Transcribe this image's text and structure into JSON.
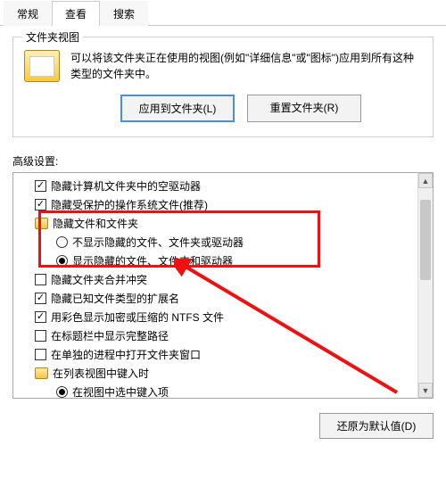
{
  "tabs": {
    "t0": "常规",
    "t1": "查看",
    "t2": "搜索"
  },
  "group": {
    "label": "文件夹视图",
    "desc": "可以将该文件夹正在使用的视图(例如\"详细信息\"或\"图标\")应用到所有这种类型的文件夹中。",
    "apply": "应用到文件夹(L)",
    "reset": "重置文件夹(R)"
  },
  "adv_label": "高级设置:",
  "items": [
    {
      "type": "check",
      "checked": true,
      "label": "隐藏计算机文件夹中的空驱动器"
    },
    {
      "type": "check",
      "checked": true,
      "label": "隐藏受保护的操作系统文件(推荐)"
    },
    {
      "type": "folder",
      "label": "隐藏文件和文件夹"
    },
    {
      "type": "radio",
      "selected": false,
      "sub": true,
      "label": "不显示隐藏的文件、文件夹或驱动器"
    },
    {
      "type": "radio",
      "selected": true,
      "sub": true,
      "label": "显示隐藏的文件、文件夹和驱动器"
    },
    {
      "type": "check",
      "checked": false,
      "label": "隐藏文件夹合并冲突"
    },
    {
      "type": "check",
      "checked": true,
      "label": "隐藏已知文件类型的扩展名"
    },
    {
      "type": "check",
      "checked": true,
      "label": "用彩色显示加密或压缩的 NTFS 文件"
    },
    {
      "type": "check",
      "checked": false,
      "label": "在标题栏中显示完整路径"
    },
    {
      "type": "check",
      "checked": false,
      "label": "在单独的进程中打开文件夹窗口"
    },
    {
      "type": "folder",
      "label": "在列表视图中键入时"
    },
    {
      "type": "radio",
      "selected": true,
      "sub": true,
      "label": "在视图中选中键入项"
    }
  ],
  "restore": "还原为默认值(D)"
}
